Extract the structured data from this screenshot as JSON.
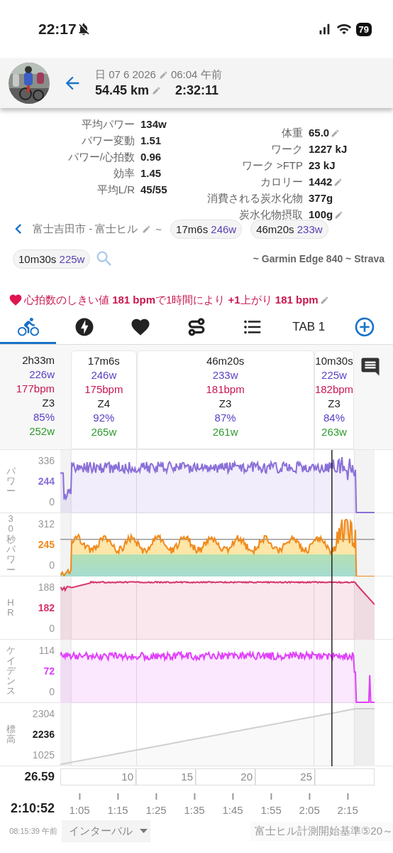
{
  "status_bar": {
    "time": "22:17",
    "battery": "79"
  },
  "header": {
    "date": "日 07 6 2026",
    "time": "06:04 午前",
    "distance": "54.45 km",
    "duration": "2:32:11"
  },
  "stats_left": [
    {
      "label": "平均パワー",
      "value": "134w",
      "editable": false
    },
    {
      "label": "パワー変動",
      "value": "1.51",
      "editable": false
    },
    {
      "label": "パワー/心拍数",
      "value": "0.96",
      "editable": false
    },
    {
      "label": "効率",
      "value": "1.45",
      "editable": false
    },
    {
      "label": "平均L/R",
      "value": "45/55",
      "editable": false
    }
  ],
  "stats_right": [
    {
      "label": "体重",
      "value": "65.0",
      "editable": true
    },
    {
      "label": "ワーク",
      "value": "1227 kJ",
      "editable": false
    },
    {
      "label": "ワーク >FTP",
      "value": "23 kJ",
      "editable": false
    },
    {
      "label": "カロリー",
      "value": "1442",
      "editable": true
    },
    {
      "label": "消費される炭水化物",
      "value": "377g",
      "editable": false
    },
    {
      "label": "炭水化物摂取",
      "value": "100g",
      "editable": true
    }
  ],
  "segment": {
    "name": "富士吉田市 - 富士ヒル",
    "separator": "~",
    "device": "~ Garmin Edge 840 ~ Strava",
    "chips": [
      {
        "time": "17m6s",
        "power": "246w"
      },
      {
        "time": "46m20s",
        "power": "233w"
      },
      {
        "time": "10m30s",
        "power": "225w"
      }
    ]
  },
  "hr_threshold": "心拍数のしきい値 **181 bpm**で1時間により **+1**上がり **181 bpm**",
  "tabs": [
    {
      "kind": "bike",
      "selected": true
    },
    {
      "kind": "power",
      "selected": false
    },
    {
      "kind": "heart",
      "selected": false
    },
    {
      "kind": "route",
      "selected": false
    },
    {
      "kind": "list",
      "selected": false
    },
    {
      "kind": "text",
      "label": "TAB 1",
      "selected": false
    },
    {
      "kind": "add",
      "selected": false
    }
  ],
  "summary": {
    "duration": "2h33m",
    "power": "226w",
    "hr": "177bpm",
    "zone": "Z3",
    "percent": "85%",
    "max_power": "252w"
  },
  "intervals": [
    {
      "duration": "17m6s",
      "power": "246w",
      "hr": "175bpm",
      "zone": "Z4",
      "percent": "92%",
      "max_power": "265w"
    },
    {
      "duration": "46m20s",
      "power": "233w",
      "hr": "181bpm",
      "zone": "Z3",
      "percent": "87%",
      "max_power": "261w"
    },
    {
      "duration": "10m30s",
      "power": "225w",
      "hr": "182bpm",
      "zone": "Z3",
      "percent": "84%",
      "max_power": "263w"
    }
  ],
  "charts": [
    {
      "label": "パワー",
      "kind": "area",
      "color": "#8a6fd8",
      "axis_labels": [
        "336",
        "244",
        "0"
      ]
    },
    {
      "label": "30秒パワー",
      "kind": "zones",
      "color": "#f08a1c",
      "axis_labels": [
        "312",
        "245",
        "0"
      ]
    },
    {
      "label": "HR",
      "kind": "area",
      "color": "#d6336c",
      "axis_labels": [
        "188",
        "182",
        "0"
      ]
    },
    {
      "label": "ケイデンス",
      "kind": "area",
      "color": "#e040fb",
      "axis_labels": [
        "114",
        "72",
        "0"
      ]
    },
    {
      "label": "標高",
      "kind": "area",
      "color": "#cfcfcf",
      "axis_labels": [
        "2304",
        "2236",
        "1025"
      ]
    }
  ],
  "distance_axis": {
    "start": "26.59",
    "ticks": [
      "10",
      "15",
      "20",
      "25"
    ]
  },
  "time_axis": {
    "cursor": "2:10:52",
    "ticks": [
      "1:05",
      "1:15",
      "1:25",
      "1:35",
      "1:45",
      "1:55",
      "2:05",
      "2:15"
    ]
  },
  "footer": {
    "clock": "08:15:39 午前",
    "mode": "インターバル",
    "segment": "富士ヒル計測開始基準⑤20～"
  }
}
